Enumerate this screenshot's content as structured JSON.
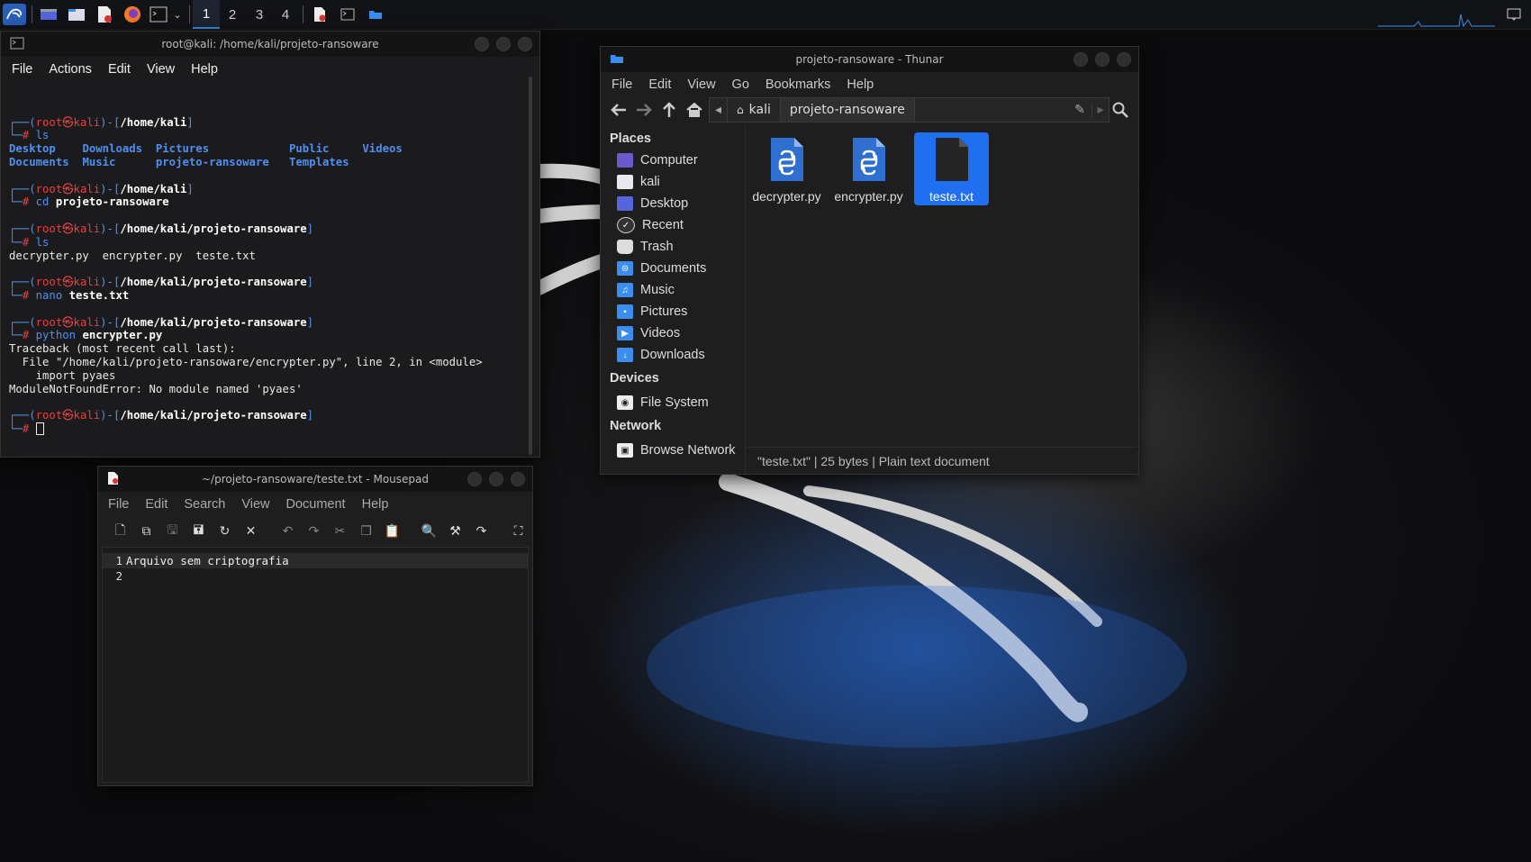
{
  "taskbar": {
    "workspaces": [
      "1",
      "2",
      "3",
      "4"
    ],
    "active_workspace": "1",
    "icons": [
      "kali-menu-icon",
      "desktop-show-icon",
      "file-manager-icon",
      "text-editor-icon",
      "firefox-icon",
      "terminal-icon",
      "dropdown-icon",
      "mousepad-task-icon",
      "terminal-task-icon",
      "thunar-task-icon",
      "notification-icon"
    ]
  },
  "terminal": {
    "title": "root@kali: /home/kali/projeto-ransoware",
    "menu": [
      "File",
      "Actions",
      "Edit",
      "View",
      "Help"
    ],
    "prompts": [
      {
        "user": "root",
        "host": "kali",
        "path": "/home/kali",
        "cmd": "ls",
        "arg": ""
      },
      {
        "user": "root",
        "host": "kali",
        "path": "/home/kali",
        "cmd": "cd",
        "arg": "projeto-ransoware"
      },
      {
        "user": "root",
        "host": "kali",
        "path": "/home/kali/projeto-ransoware",
        "cmd": "ls",
        "arg": ""
      },
      {
        "user": "root",
        "host": "kali",
        "path": "/home/kali/projeto-ransoware",
        "cmd": "nano",
        "arg": "teste.txt"
      },
      {
        "user": "root",
        "host": "kali",
        "path": "/home/kali/projeto-ransoware",
        "cmd": "python",
        "arg": "encrypter.py"
      },
      {
        "user": "root",
        "host": "kali",
        "path": "/home/kali/projeto-ransoware",
        "cmd": "",
        "arg": ""
      }
    ],
    "ls_home": [
      [
        "Desktop",
        "Downloads",
        "Pictures",
        "Public",
        "Videos"
      ],
      [
        "Documents",
        "Music",
        "projeto-ransoware",
        "Templates"
      ]
    ],
    "ls_project": "decrypter.py  encrypter.py  teste.txt",
    "traceback": [
      "Traceback (most recent call last):",
      "  File \"/home/kali/projeto-ransoware/encrypter.py\", line 2, in <module>",
      "    import pyaes",
      "ModuleNotFoundError: No module named 'pyaes'"
    ]
  },
  "thunar": {
    "title": "projeto-ransoware - Thunar",
    "menu": [
      "File",
      "Edit",
      "View",
      "Go",
      "Bookmarks",
      "Help"
    ],
    "path": [
      "kali",
      "projeto-ransoware"
    ],
    "places_header": "Places",
    "places": [
      "Computer",
      "kali",
      "Desktop",
      "Recent",
      "Trash",
      "Documents",
      "Music",
      "Pictures",
      "Videos",
      "Downloads"
    ],
    "devices_header": "Devices",
    "devices": [
      "File System"
    ],
    "network_header": "Network",
    "network": [
      "Browse Network"
    ],
    "files": [
      {
        "name": "decrypter.py",
        "type": "python"
      },
      {
        "name": "encrypter.py",
        "type": "python"
      },
      {
        "name": "teste.txt",
        "type": "text",
        "selected": true
      }
    ],
    "status": "\"teste.txt\"  |  25 bytes  |  Plain text document"
  },
  "mousepad": {
    "title": "~/projeto-ransoware/teste.txt - Mousepad",
    "menu": [
      "File",
      "Edit",
      "Search",
      "View",
      "Document",
      "Help"
    ],
    "lines": [
      {
        "num": "1",
        "text": "Arquivo sem criptografia"
      },
      {
        "num": "2",
        "text": ""
      }
    ]
  }
}
